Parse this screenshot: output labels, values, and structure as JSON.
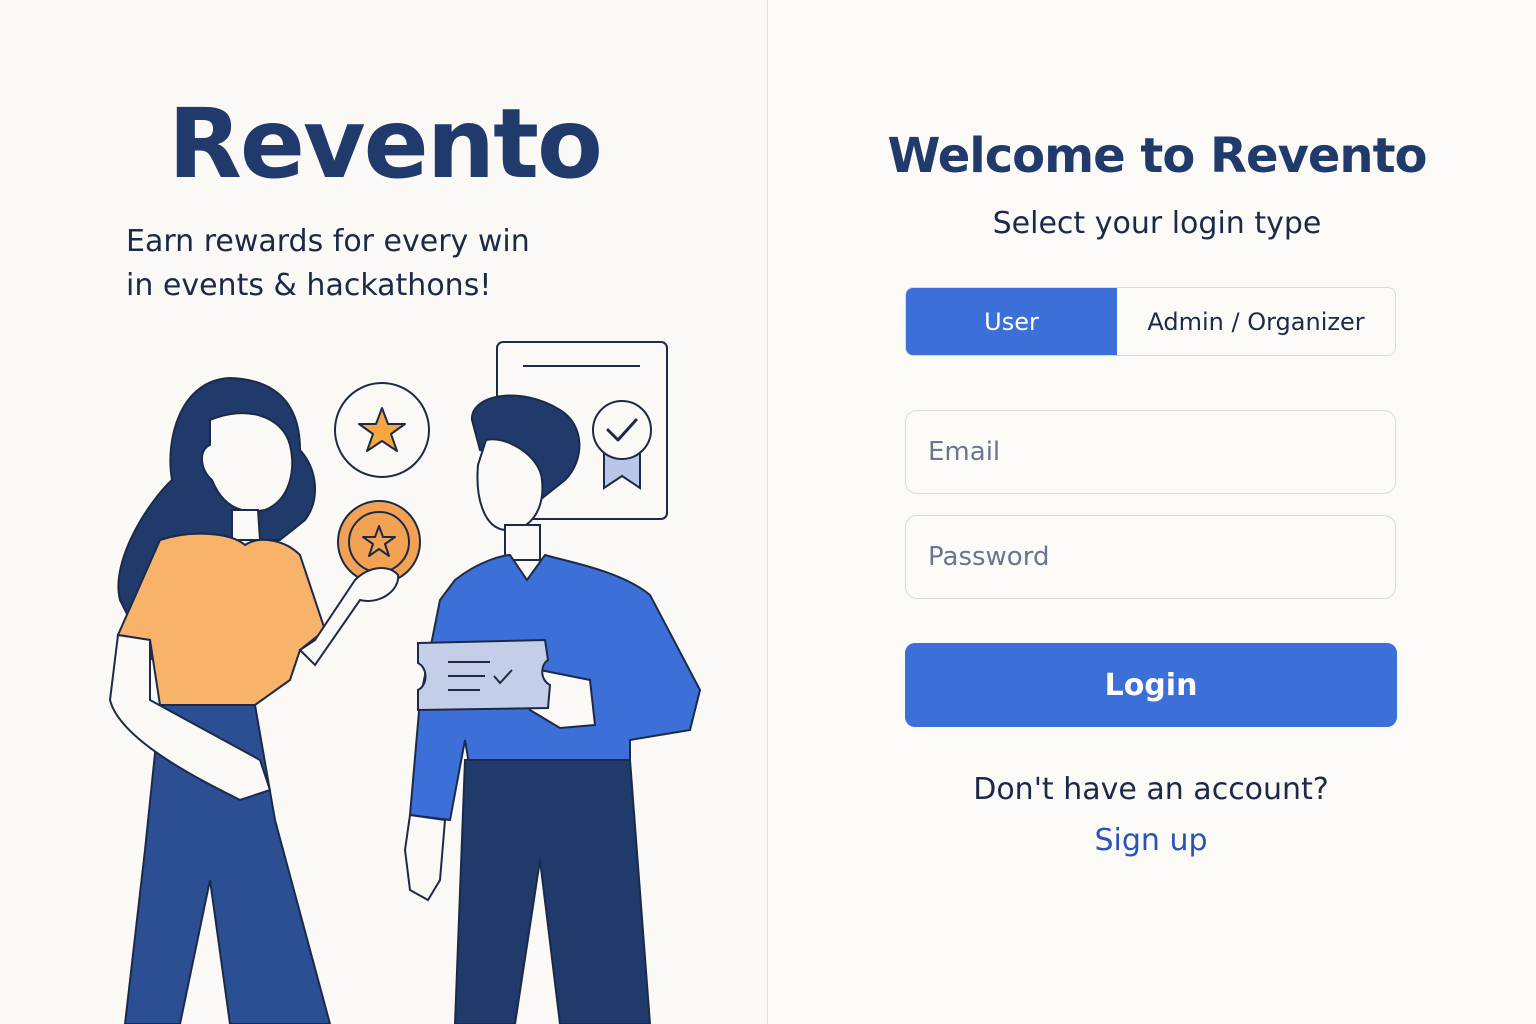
{
  "brand": {
    "name": "Revento",
    "tagline_line1": "Earn rewards for every win",
    "tagline_line2": "in events & hackathons!"
  },
  "login": {
    "title": "Welcome to Revento",
    "subtitle": "Select your login type",
    "types": [
      {
        "label": "User",
        "selected": true
      },
      {
        "label": "Admin / Organizer",
        "selected": false
      }
    ],
    "email_placeholder": "Email",
    "password_placeholder": "Password",
    "submit_label": "Login",
    "no_account_text": "Don't have an account?",
    "signup_label": "Sign up"
  },
  "colors": {
    "background": "#fbf9f5",
    "brand_navy": "#1f3a6b",
    "accent_blue": "#3d6fd8",
    "link_blue": "#2a52b8",
    "orange": "#f8b26a"
  },
  "icons": [
    "star-icon",
    "coin-icon",
    "certificate-icon",
    "checkmark-icon",
    "ticket-icon"
  ]
}
